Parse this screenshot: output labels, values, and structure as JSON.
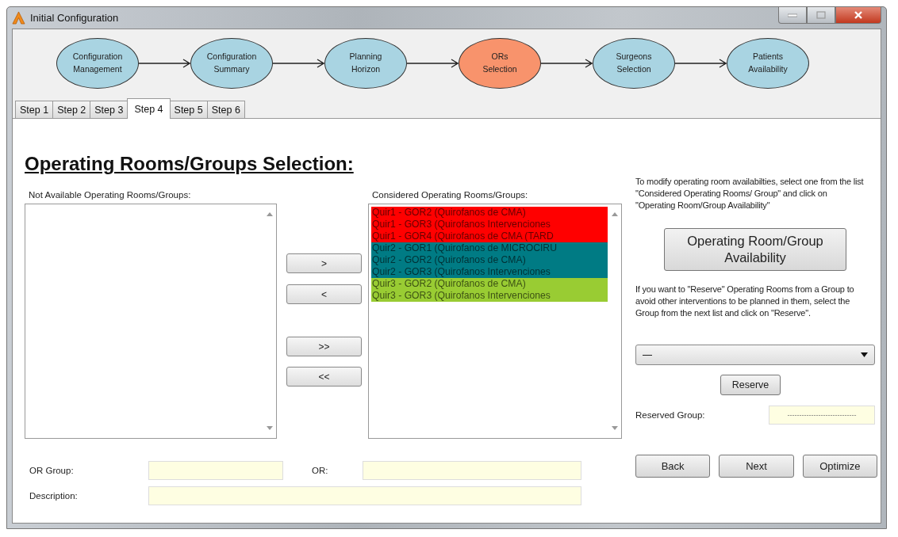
{
  "window": {
    "title": "Initial Configuration"
  },
  "workflow": [
    {
      "label": "Configuration Management",
      "selected": false
    },
    {
      "label": "Configuration Summary",
      "selected": false
    },
    {
      "label": "Planning Horizon",
      "selected": false
    },
    {
      "label": "ORs Selection",
      "selected": true
    },
    {
      "label": "Surgeons Selection",
      "selected": false
    },
    {
      "label": "Patients Availability",
      "selected": false
    }
  ],
  "tabs": [
    {
      "label": "Step 1",
      "selected": false
    },
    {
      "label": "Step 2",
      "selected": false
    },
    {
      "label": "Step 3",
      "selected": false
    },
    {
      "label": "Step 4",
      "selected": true
    },
    {
      "label": "Step 5",
      "selected": false
    },
    {
      "label": "Step 6",
      "selected": false
    }
  ],
  "heading": "Operating Rooms/Groups Selection:",
  "not_available": {
    "label": "Not Available Operating Rooms/Groups:"
  },
  "transfer_buttons": [
    ">",
    "<",
    ">>",
    "<<"
  ],
  "considered": {
    "label": "Considered Operating Rooms/Groups:",
    "items": [
      {
        "text": "Quir1 - GOR2 (Quirofanos de CMA)",
        "color": "#ff0000"
      },
      {
        "text": "Quir1 - GOR3 (Quirofanos Intervenciones",
        "color": "#ff0000"
      },
      {
        "text": "Quir1 - GOR4 (Quirofanos de CMA (TARD",
        "color": "#ff0000"
      },
      {
        "text": "Quir2 - GOR1 (Quirofanos de MICROCIRU",
        "color": "#007b84"
      },
      {
        "text": "Quir2 - GOR2 (Quirofanos de CMA)",
        "color": "#007b84"
      },
      {
        "text": "Quir2 - GOR3 (Quirofanos Intervenciones",
        "color": "#007b84"
      },
      {
        "text": "Quir3 - GOR2 (Quirofanos de CMA)",
        "color": "#99cc33"
      },
      {
        "text": "Quir3 - GOR3 (Quirofanos Intervenciones",
        "color": "#99cc33"
      }
    ]
  },
  "instructions": "To modify operating room availabilties, select one from the list \"Considered Operating Rooms/ Group\" and click on \"Operating Room/Group Availability\"",
  "availability_button": "Operating Room/Group Availability",
  "reserve_instructions": "If you want to \"Reserve\" Operating Rooms from a Group to avoid other interventions to be planned in them, select the Group from the next list and click on \"Reserve\".",
  "group_dropdown": {
    "value": "—"
  },
  "reserve_button": "Reserve",
  "reserved_group": {
    "label": "Reserved Group:",
    "value": "-----------------------------"
  },
  "fields": [
    {
      "label": "OR Group:"
    },
    {
      "label": "OR:"
    },
    {
      "label": "Description:"
    }
  ],
  "buttons": [
    "Back",
    "Next",
    "Optimize"
  ]
}
